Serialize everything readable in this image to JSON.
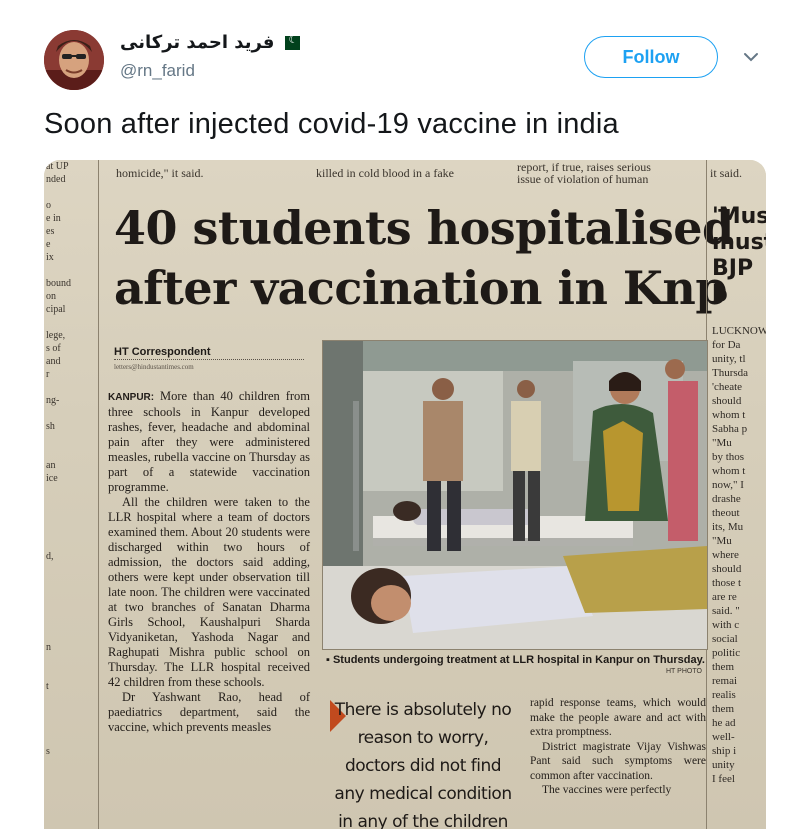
{
  "tweet": {
    "display_name": "فريد احمد ترکانی",
    "handle": "@rn_farid",
    "follow_label": "Follow",
    "text": "Soon after injected covid-19 vaccine in india"
  },
  "newspaper": {
    "top_strip": [
      "homicide,\" it said.",
      "killed in cold blood in a fake",
      "report, if true, raises serious",
      "issue of violation of human",
      "it said."
    ],
    "headline_line1": "40 students hospitalised",
    "headline_line2": "after vaccination in Knp",
    "byline": "HT Correspondent",
    "byline_email": "letters@hindustantimes.com",
    "dateline": "KANPUR:",
    "para1": "More than 40 children from three schools in Kanpur developed rashes, fever, headache and abdominal pain after they were administered measles, rubella vaccine on Thursday as part of a statewide vaccination programme.",
    "para2": "All the children were taken to the LLR hospital where a team of doctors examined them. About 20 students were discharged within two hours of admission, the doctors said adding, others were kept under observation till late noon. The children were vaccinated at two branches of Sanatan Dharma Girls School, Kaushalpuri Sharda Vidyaniketan, Yashoda Nagar and Raghupati Mishra public school on Thursday. The LLR hospital received 42 children from these schools.",
    "para3": "Dr Yashwant Rao, head of paediatrics department, said the vaccine, which prevents measles",
    "photo_caption": "Students undergoing treatment at LLR hospital in Kanpur on Thursday.",
    "photo_credit": "HT PHOTO",
    "pull_quote": "There is absolutely no reason to worry, doctors did not find any medical condition in any of the children during the",
    "right_para1": "rapid response teams, which would make the people aware and act with extra promptness.",
    "right_para2": "District magistrate Vijay Vishwas Pant said such symptoms were common after vaccination.",
    "right_para3": "The vaccines were perfectly",
    "left_strip": [
      "at UP",
      "nded",
      "",
      "o",
      "e in",
      "es",
      "e",
      "ix",
      "",
      "bound",
      "on",
      "cipal",
      "",
      "lege,",
      "s of",
      "and",
      "r",
      "",
      "ng-",
      "",
      "sh",
      "",
      "",
      "an",
      "ice",
      "",
      "",
      "",
      "",
      "",
      "d,",
      "",
      "",
      "",
      "",
      "",
      "",
      "n",
      "",
      "",
      "t",
      "",
      "",
      "",
      "",
      "s"
    ],
    "right_col_head": [
      "'Musli",
      "must",
      "BJP b"
    ],
    "right_col_body": [
      "LUCKNOW",
      "for Da",
      "unity, tl",
      "Thursda",
      "'cheate",
      "should",
      "whom t",
      "Sabha p",
      "\"Mu",
      "by thos",
      "whom t",
      "now,\" I",
      "drashe",
      "theout",
      "its, Mu",
      "\"Mu",
      "where",
      "should",
      "those t",
      "are re",
      "said. \"",
      "with c",
      "social",
      "politic",
      "them",
      "remai",
      "realis",
      "them",
      "he ad",
      "well-",
      "ship i",
      "unity",
      "I feel"
    ]
  }
}
